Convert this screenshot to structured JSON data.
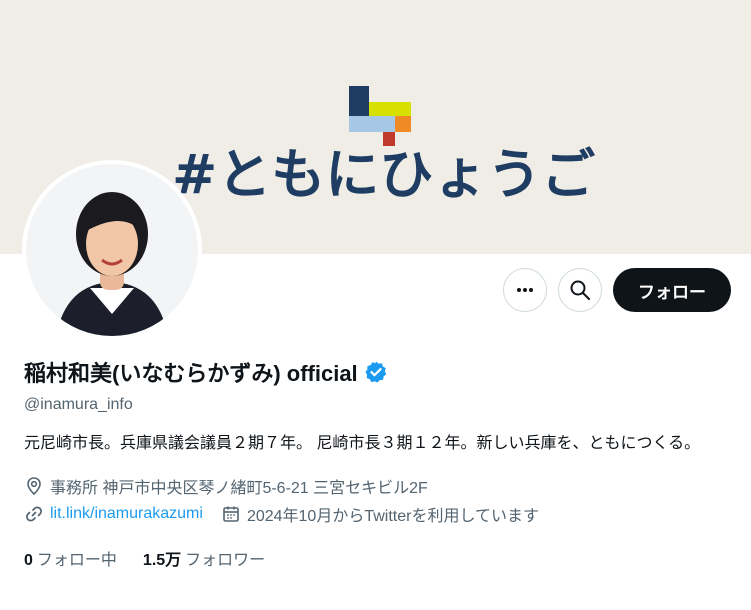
{
  "banner": {
    "logo_icon": "hyogo-blocks-logo-icon",
    "text": "#ともにひょうご",
    "colors": {
      "background": "#efede6",
      "text": "#1f3d63"
    }
  },
  "avatar": {
    "icon": "profile-photo-avatar"
  },
  "actions": {
    "more_icon": "more-horizontal-icon",
    "search_icon": "search-icon",
    "follow_label": "フォロー"
  },
  "profile": {
    "name": "稲村和美(いなむらかずみ) official",
    "verified_icon": "verified-badge-icon",
    "handle": "@inamura_info",
    "bio": "元尼崎市長。兵庫県議会議員２期７年。 尼崎市長３期１２年。新しい兵庫を、ともにつくる。",
    "location_icon": "location-pin-icon",
    "location": "事務所 神戸市中央区琴ノ緒町5-6-21 三宮セキビル2F",
    "link_icon": "link-icon",
    "link": "lit.link/inamurakazumi",
    "calendar_icon": "calendar-icon",
    "joined": "2024年10月からTwitterを利用しています"
  },
  "counts": {
    "following_num": "0",
    "following_label": "フォロー中",
    "followers_num": "1.5万",
    "followers_label": "フォロワー"
  },
  "colors": {
    "accent": "#1d9bf0",
    "primary_text": "#0f1419",
    "secondary_text": "#536471"
  }
}
